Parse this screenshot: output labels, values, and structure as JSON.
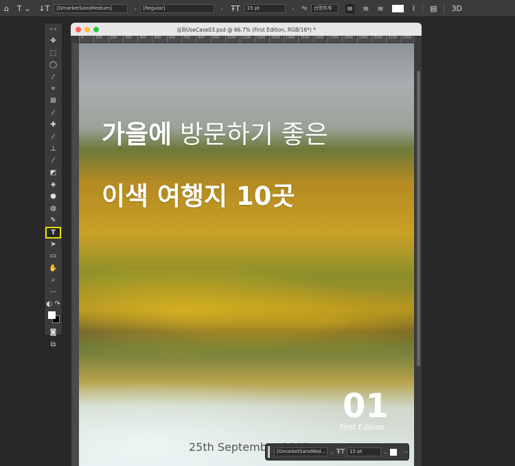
{
  "options_bar": {
    "font_family": "[GmarketSansMedium]",
    "font_style": "[Regular]",
    "font_size": "15 pt",
    "anti_alias": "선명하게",
    "text_color": "#ffffff"
  },
  "document": {
    "title": "심화UseCase03.psd @ 66.7% (First Edition, RGB/16*) *",
    "ruler_ticks": [
      "0",
      "100",
      "200",
      "300",
      "400",
      "500",
      "600",
      "700",
      "800",
      "900",
      "1000",
      "1100",
      "1200",
      "1300",
      "1400",
      "1500",
      "1600",
      "1700",
      "1800",
      "1900",
      "2000",
      "2100",
      "2200"
    ]
  },
  "canvas": {
    "headline_bold_1": "가을에",
    "headline_light_1": "방문하기 좋은",
    "headline_2": "이색 여행지 10곳",
    "issue_number": "01",
    "edition": "First Edition",
    "date": "25th September 2022"
  },
  "floating_bar": {
    "font_family": "[GmarketSansMed...",
    "font_size": "15 pt",
    "more": "···"
  },
  "toolbar": {
    "selected_tool": "type-tool"
  }
}
